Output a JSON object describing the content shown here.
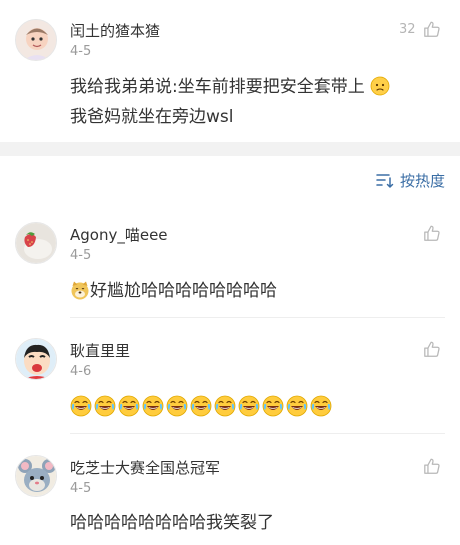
{
  "post": {
    "user_name": "闰土的猹本猹",
    "date": "4-5",
    "like_count": "32",
    "text_line1": "我给我弟弟说:坐车前排要把安全套带上",
    "text_line2": "我爸妈就坐在旁边wsl"
  },
  "sort": {
    "label": "按热度",
    "icon": "sort-icon"
  },
  "comments": [
    {
      "user_name": "Agony_喵eee",
      "date": "4-5",
      "text": "好尴尬哈哈哈哈哈哈哈哈"
    },
    {
      "user_name": "耿直里里",
      "date": "4-6",
      "laugh_emoji_count": 11
    },
    {
      "user_name": "吃芝士大赛全国总冠军",
      "date": "4-5",
      "text": "哈哈哈哈哈哈哈哈我笑裂了"
    }
  ],
  "colors": {
    "link": "#3b6ea5",
    "divider": "#f2f2f2",
    "muted": "#9a9a9a"
  }
}
